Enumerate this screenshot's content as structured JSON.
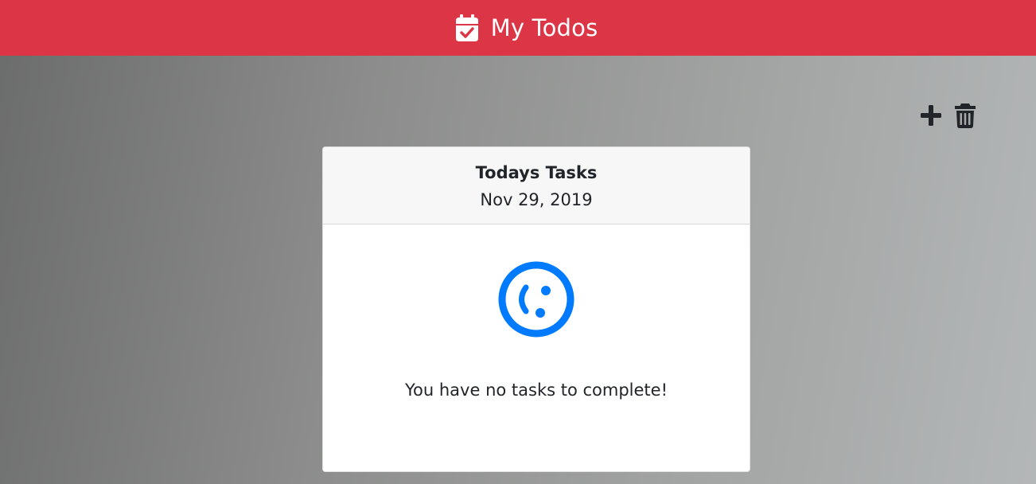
{
  "header": {
    "title": "My Todos",
    "icon": "calendar-check-icon",
    "background_color": "#dc3545"
  },
  "toolbar": {
    "add_icon": "plus-icon",
    "clear_icon": "trash-icon"
  },
  "card": {
    "title": "Todays Tasks",
    "date": "Nov 29, 2019",
    "empty_icon": "meh-face-icon",
    "empty_icon_color": "#007bff",
    "empty_message": "You have no tasks to complete!"
  }
}
